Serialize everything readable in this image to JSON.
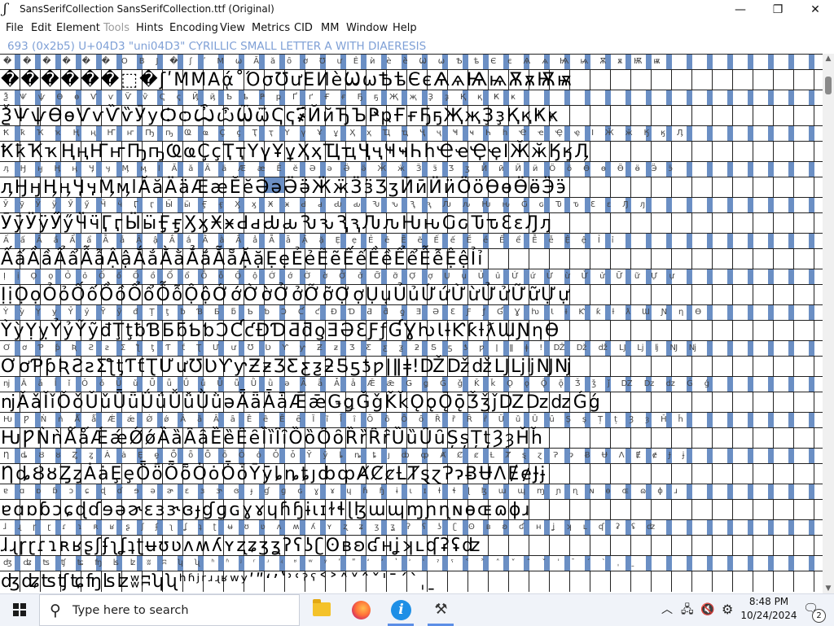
{
  "window": {
    "title": "SansSerifCollection  SansSerifCollection.ttf (Original)",
    "minimize_glyph": "—",
    "maximize_glyph": "❐",
    "close_glyph": "✕",
    "app_icon_glyph": "ʃ"
  },
  "menu": [
    "File",
    "Edit",
    "Element",
    "Tools",
    "Hints",
    "Encoding",
    "View",
    "Metrics",
    "CID",
    "MM",
    "Window",
    "Help"
  ],
  "info_line": "693 (0x2b5) U+04D3 \"uni04D3\" CYRILLIC SMALL LETTER A WITH DIAERESIS",
  "accent_color": "#6b8fc4",
  "grid_rows": [
    {
      "labels": "������OBJ�ʃʹМѡĂăȏơƱưЀѝѐѐ̀ѠѡѢѣЄєѦѧѨѩѪѫѬѭ",
      "glyphs": "������⬚�ʃʹММАᾴ˚ΌσƱưЕИèѠѡѢѣЄєѦѧѨѩѪѫѬѭ"
    },
    {
      "labels": "ѮѰѱѲѳѴѵѶѷҀҁҊҋҌҍҎҏҐґҒғҔҕҖҗҘҙҚқҜҝ",
      "glyphs": "ѮѰѱѲѳѴѵѶѷӮуѺѻѼѽѾѿҀҁ҂҃҄ЙйЂЪҎҏҒғҔҕҖҗҘҙҚқҜҝ"
    },
    {
      "labels": "ҞҟҠҡҢңҤҥҦҧҨҩҪҫҬҭҮүҰұҲҳҴҵҶҷҸҹҺһҼҽҾҿӀӁӂӃӄӅ",
      "glyphs": "ҞҟҠҡҢңҤҥҦҧҨҩҪҫҬҭҮүҰұҲҳҴҵҶҷҸҹҺһҼҽҾҿӀӁӂӃӄӅ"
    },
    {
      "labels": "ӆӇӈӉӊӋӌӍӎӏӐӑӒӓӔӕӖӗӘәӚӛӜӝӞӟӠӡӢӣӤӥӦӧӨөӪӫӬӭ",
      "glyphs": "ӆӇӈӉӊӋӌӍӎӏӐӑӒӓӔӕӖӗӘәӚӛӜӝӞӟӠӡӢӣӤӥӦӧӨөӪӫӬӭ"
    },
    {
      "labels": "ӮӯӰӱӲӳӴӵӶӷӸӹӺӻӼӽӾӿԀԁԂԃԄԅԆԇԈԉԊԋԌԍԎԏԐԑԒԓ",
      "glyphs": "ӮӯӰӱӲӳӴӵӶӷӸӹӺӻӼӽӾӿԀԁԂԃԄԅԆԇԈԉԊԋԌԍԎԏԐԑԒԓ"
    },
    {
      "labels": "ẤấẦầẨẩẪẫẬậẮắẰằẲẳẴẵẶặẸẹẺẻẼẽẾếỀềỂểỄễỆệỈỉ",
      "glyphs": "ẤấẦầẨẩẪẫẬậẮắẰằẲẳẴẵẶặẸẹẺẻẼẽẾếỀềỂểỄễỆệỈỉ"
    },
    {
      "labels": "ỊịỌọỎỏỐốỒồỔổỖỗỘộỚớỜờỞởỠỡỢợỤụỦủỨứỪừỬửỮữỰự",
      "glyphs": "ỊịỌọỎỏỐốỒồỔổỖỗỘộỚớỜờỞởỠỡỢợỤụỦủỨứỪừỬửỮữỰự"
    },
    {
      "labels": "ỲỳỴỵỶỷỸỹđŢţƀƁƂƃƄƅƆƇƈƉƊƋƌƍƎƏƐƑƒƓƔƕƖƗƘƙƚƛƜƝƞƟ",
      "glyphs": "ỲỳỴỵỶỷỸỹđŢţƀƁƂƃƄƅƆƇƈƉƊƋƌƍƎƏƐƑƒƓƔƕƖƗƘƙƚƛƜƝƞƟ"
    },
    {
      "labels": "ƠơƤƥƦƧƨƩƪƫƬƭƮƯưƱƲƳƴƵƶƷƸƹƺƻƼƽƾƿǀǁǂǃǄǅǆǇǈǉǊǋ",
      "glyphs": "ƠơƤƥƦƧƨƩƪƫƬƭƮƯưƱƲƳƴƵƶƷƸƹƺƻƼƽƾƿǀǁǂǃǄǅǆǇǈǉǊǋ"
    },
    {
      "labels": "ǌǍǎǏǐǑǒǓǔǕǖǗǘǙǚǛǜǝǞǟǠǡǢǣǤǥǦǧǨǩǪǫǬǭǮǯǰǱǲǳǴǵ",
      "glyphs": "ǌǍǎǏǐǑǒǓǔǕǖǗǘǙǚǛǜǝǞǟǠǡǢǣǤǥǦǧǨǩǪǫǬǭǮǯǰǱǲǳǴǵ"
    },
    {
      "labels": "ǶǷǸǹǺǻǼǽǾǿȀȁȂȃȄȅȆȇȈȉȊȋȌȍȎȏȐȑȒȓȔȕȖȗȘșȚțȜȝȞȟ",
      "glyphs": "ǶǷǸǹǺǻǼǽǾǿȀȁȂȃȄȅȆȇȈȉȊȋȌȍȎȏȐȑȒȓȔȕȖȗȘșȚțȜȝȞȟ"
    },
    {
      "labels": "ȠȡȢȣȤȥȦȧȨȩȪȫȬȭȮȯȰȱȲȳȴȵȶȷȸȹȺȻȼȽȾȿɀɁɂɃɄɅɆɇɈɉ",
      "glyphs": "ȠȡȢȣȤȥȦȧȨȩȪȫȬȭȮȯȰȱȲȳȴȵȶȷȸȹȺȻȼȽȾȿɀɁɂɃɄɅɆɇɈɉ"
    },
    {
      "labels": "ɐɑɒɓɔɕɖɗɘəɚɛɜɝɞɟɠɡɢɣɤɥɦɧɨɩɪɫɬɭɮɯɰɱɲɳɴɵɶɷɸɹ",
      "glyphs": "ɐɑɒɓɔɕɖɗɘəɚɛɜɝɞɟɠɡɢɣɤɥɦɧɨɩɪɫɬɭɮɯɰɱɲɳɴɵɶɷɸɹ"
    },
    {
      "labels": "ɺɻɼɽɾɿʀʁʂʃʄʅʆʇʈʉʊʋʌʍʎʏʐʑʒʓʔʕʖʗʘʙʚʛʜʝʞʟʠʡʢʣ",
      "glyphs": "ɺɻɼɽɾɿʀʁʂʃʄʅʆʇʈʉʊʋʌʍʎʏʐʑʒʓʔʕʖʗʘʙʚʛʜʝʞʟʠʡʢʣ"
    },
    {
      "labels": "ʤʥʦʧʨʩʪʫʬʭʮʯʰʱʲʳʴʵʶʷʸʹʺʻʼʽʾʿˀˁ˂˃˄˅ˆˇˈˉˊˋˌˍ",
      "glyphs": "ʤʥʦʧʨʩʪʫʬʭʮʯʰʱʲʳʴʵʶʷʸʹʺʻʼʽʾʿˀˁ˂˃˄˅ˆˇˈˉˊˋˌˍ"
    }
  ],
  "scrollbar": {
    "up_glyph": "▲",
    "down_glyph": "▼"
  },
  "taskbar": {
    "search_placeholder": "Type here to search",
    "search_glyph": "⚲",
    "info_glyph": "i",
    "fontforge_glyph": "⚒",
    "tray_chevron": "︿",
    "tray_network": "🖧",
    "tray_volume": "🔇",
    "tray_gear": "⚙",
    "time": "8:48 PM",
    "date": "10/24/2024",
    "notifications_glyph": "🗨",
    "notifications_count": "2"
  }
}
